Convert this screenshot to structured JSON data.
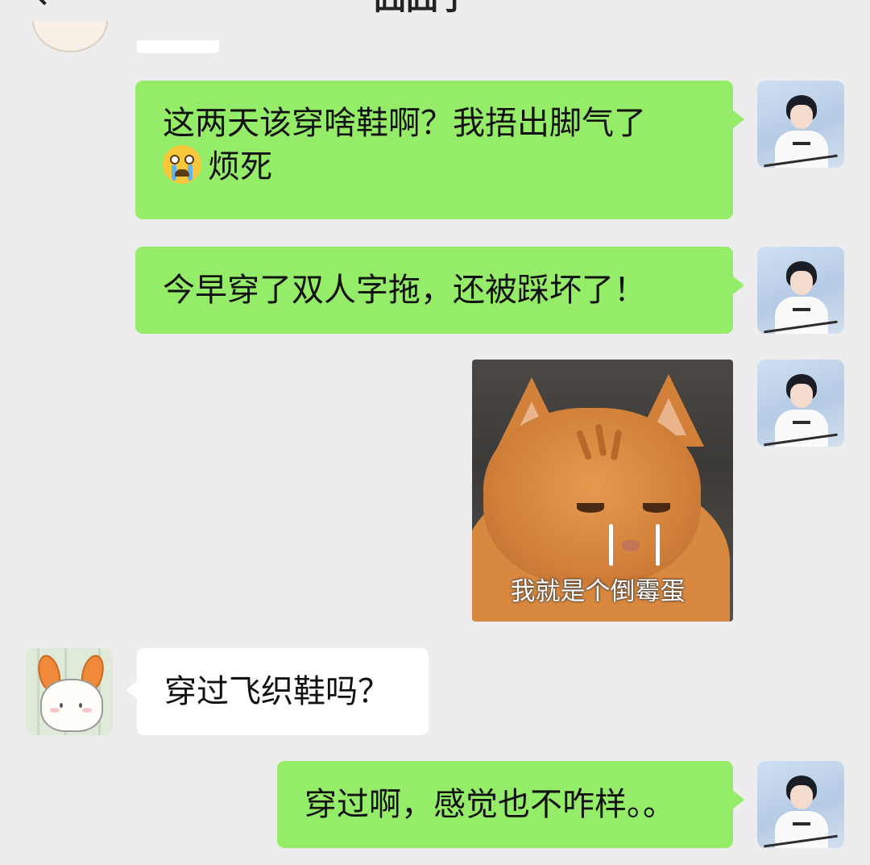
{
  "header": {
    "back_icon": "chevron-left-icon",
    "title": "囧囧子"
  },
  "messages": [
    {
      "sender": "me",
      "type": "text",
      "emoji": "crying-face-emoji",
      "line1": "这两天该穿啥鞋啊？我捂出脚气了",
      "line2": "烦死"
    },
    {
      "sender": "me",
      "type": "text",
      "text": "今早穿了双人字拖，还被踩坏了！"
    },
    {
      "sender": "me",
      "type": "sticker",
      "sticker_caption": "我就是个倒霉蛋"
    },
    {
      "sender": "friend",
      "type": "text",
      "text": "穿过飞织鞋吗？"
    },
    {
      "sender": "me",
      "type": "text",
      "text": "穿过啊，感觉也不咋样。。"
    }
  ],
  "colors": {
    "background": "#ededed",
    "my_bubble": "#95ec69",
    "friend_bubble": "#ffffff"
  }
}
